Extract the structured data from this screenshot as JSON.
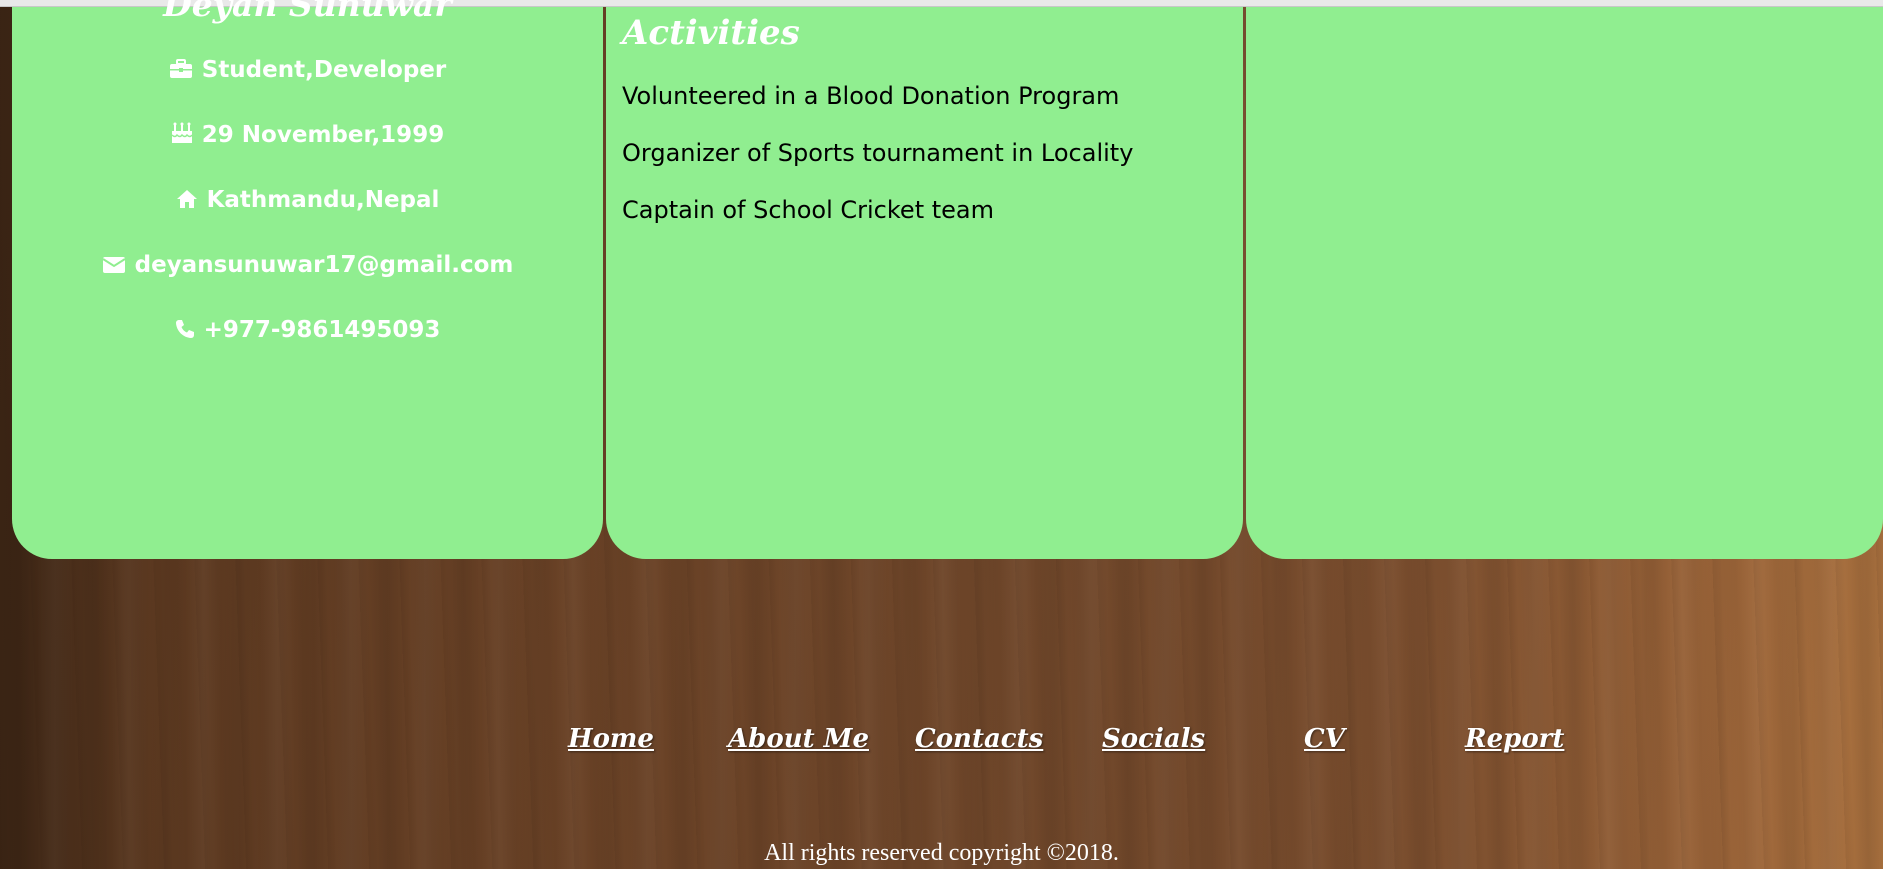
{
  "profile": {
    "name": "Deyan Sunuwar",
    "role": "Student,Developer",
    "birthday": "29 November,1999",
    "address": "Kathmandu,Nepal",
    "email": "deyansunuwar17@gmail.com",
    "phone": "+977-9861495093",
    "icons": [
      "briefcase-icon",
      "birthday-cake-icon",
      "home-icon",
      "envelope-icon",
      "phone-icon"
    ]
  },
  "activities": {
    "title": "Activities",
    "items": [
      "Volunteered in a Blood Donation Program",
      "Organizer of Sports tournament in Locality",
      "Captain of School Cricket team"
    ]
  },
  "footer": {
    "nav": [
      "Home",
      "About Me",
      "Contacts",
      "Socials",
      "CV",
      "Report"
    ],
    "copyright": "All rights reserved copyright ©2018."
  },
  "colors": {
    "card_background": "#90ee90",
    "card_text": "#ffffff",
    "activity_text": "#000000",
    "wood_background": "#70472a"
  }
}
